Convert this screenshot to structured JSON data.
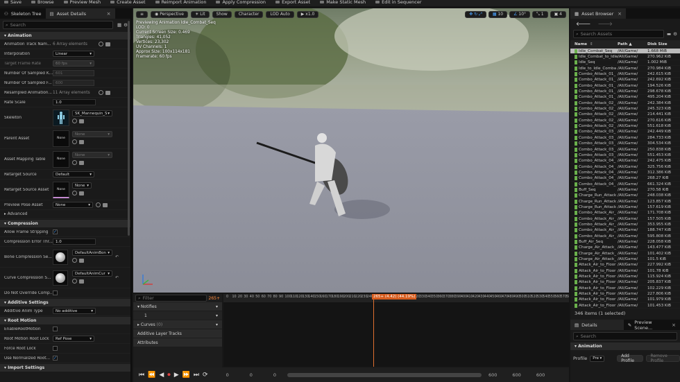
{
  "toolbar": {
    "items": [
      "Save",
      "Browse",
      "Preview Mesh",
      "Create Asset",
      "Reimport Animation",
      "Apply Compression",
      "Export Asset",
      "Make Static Mesh",
      "Edit in Sequencer"
    ]
  },
  "left_panel": {
    "tabs": [
      {
        "label": "Skeleton Tree"
      },
      {
        "label": "Asset Details"
      }
    ],
    "search_placeholder": "Search",
    "categories": {
      "animation": "Animation",
      "compression": "Compression",
      "additive": "Additive Settings",
      "root_motion": "Root Motion",
      "import": "Import Settings"
    },
    "rows": {
      "track_names": {
        "label": "Animation Track Nam...",
        "value": "6 Array elements"
      },
      "interpolation": {
        "label": "Interpolation",
        "value": "Linear"
      },
      "target_frame_rate": {
        "label": "Target Frame Rate",
        "value": "60 fps"
      },
      "num_sampled_keys": {
        "label": "Number Of Sampled K...",
        "value": "601"
      },
      "num_sampled_frames": {
        "label": "Number Of Sampled F...",
        "value": "600"
      },
      "resampled": {
        "label": "Resampled Animation...",
        "value": "11 Array elements"
      },
      "rate_scale": {
        "label": "Rate Scale",
        "value": "1.0"
      },
      "skeleton": {
        "label": "Skeleton",
        "value": "SK_Mannequin_S"
      },
      "parent_asset": {
        "label": "Parent Asset",
        "value": "None",
        "thumb": "None"
      },
      "asset_mapping": {
        "label": "Asset Mapping Table",
        "value": "None",
        "thumb": "None"
      },
      "retarget_source": {
        "label": "Retarget Source",
        "value": "Default"
      },
      "retarget_source_asset": {
        "label": "Retarget Source Asset",
        "value": "None",
        "thumb": "None"
      },
      "preview_pose": {
        "label": "Preview Pose Asset",
        "value": "None"
      },
      "advanced": {
        "label": "Advanced"
      },
      "allow_frame_strip": {
        "label": "Allow Frame Stripping"
      },
      "comp_error": {
        "label": "Compression Error Thr...",
        "value": "1.0"
      },
      "bone_comp": {
        "label": "Bone Compression Se...",
        "value": "DefaultAnimBon"
      },
      "curve_comp": {
        "label": "Curve Compression S...",
        "value": "DefaultAnimCur"
      },
      "no_override": {
        "label": "Do Not Override Comp..."
      },
      "additive_type": {
        "label": "Additive Anim Type",
        "value": "No additive"
      },
      "enable_rm": {
        "label": "EnableRootMotion"
      },
      "rm_lock": {
        "label": "Root Motion Root Lock",
        "value": "Ref Pose"
      },
      "force_lock": {
        "label": "Force Root Lock"
      },
      "use_norm": {
        "label": "Use Normalized Root..."
      }
    }
  },
  "viewport": {
    "buttons": [
      "Perspective",
      "Lit",
      "Show",
      "Character",
      "LOD Auto",
      "x1.0"
    ],
    "right_nums": [
      "10",
      "10°",
      "1",
      "4"
    ],
    "info": [
      "Previewing Animation Idle_Combat_Seq",
      "LOD: 0",
      "Current Screen Size: 0.469",
      "Triangles: 41,052",
      "Vertices: 23,302",
      "UV Channels: 1",
      "Approx Size: 100x114x181",
      "Framerate: 60 fps"
    ]
  },
  "timeline": {
    "filter_placeholder": "Filter",
    "frame_count": "265+",
    "tracks": {
      "notifies": "Notifies",
      "notify_index": "1",
      "curves": "Curves",
      "curves_count": "(0)",
      "additive_layer": "Additive Layer Tracks",
      "attributes": "Attributes"
    },
    "playhead": "265+ (4.42) (44.19%)",
    "ticks": [
      "0",
      "10",
      "20",
      "30",
      "40",
      "50",
      "60",
      "70",
      "80",
      "90",
      "100",
      "110",
      "120",
      "130",
      "140",
      "150",
      "160",
      "170",
      "180",
      "190",
      "200",
      "210",
      "220",
      "230",
      "240",
      "250",
      "260",
      "270",
      "280",
      "290",
      "300",
      "310",
      "320",
      "330",
      "340",
      "350",
      "360",
      "370",
      "380",
      "390",
      "400",
      "410",
      "420",
      "430",
      "440",
      "450",
      "460",
      "470",
      "480",
      "490",
      "500",
      "510",
      "520",
      "530",
      "540",
      "550",
      "560",
      "570",
      "580"
    ],
    "bottom_left": [
      "0",
      "0",
      "0"
    ],
    "bottom_right": [
      "600",
      "600",
      "600"
    ]
  },
  "asset_browser": {
    "tab": "Asset Browser",
    "search_placeholder": "Search Assets",
    "columns": [
      "Name",
      "Path",
      "Disk Size"
    ],
    "rows": [
      [
        "Idle_Combat_Seq",
        "/All/Game/",
        "1.668 MiB"
      ],
      [
        "Idle_Combat_to_Idle",
        "/All/Game/",
        "270.962 KiB"
      ],
      [
        "Idle_Seq",
        "/All/Game/",
        "1.002 MiB"
      ],
      [
        "Idle_to_Idle_Comba",
        "/All/Game/",
        "270.984 KiB"
      ],
      [
        "Combo_Attack_01_",
        "/All/Game/",
        "242.615 KiB"
      ],
      [
        "Combo_Attack_01_",
        "/All/Game/",
        "242.692 KiB"
      ],
      [
        "Combo_Attack_01_",
        "/All/Game/",
        "194.526 KiB"
      ],
      [
        "Combo_Attack_01_",
        "/All/Game/",
        "298.678 KiB"
      ],
      [
        "Combo_Attack_01_",
        "/All/Game/",
        "495.204 KiB"
      ],
      [
        "Combo_Attack_02_",
        "/All/Game/",
        "242.384 KiB"
      ],
      [
        "Combo_Attack_02_",
        "/All/Game/",
        "245.323 KiB"
      ],
      [
        "Combo_Attack_02_",
        "/All/Game/",
        "214.441 KiB"
      ],
      [
        "Combo_Attack_02_",
        "/All/Game/",
        "270.616 KiB"
      ],
      [
        "Combo_Attack_02_",
        "/All/Game/",
        "551.618 KiB"
      ],
      [
        "Combo_Attack_03_",
        "/All/Game/",
        "242.449 KiB"
      ],
      [
        "Combo_Attack_03_",
        "/All/Game/",
        "284.733 KiB"
      ],
      [
        "Combo_Attack_03_",
        "/All/Game/",
        "304.534 KiB"
      ],
      [
        "Combo_Attack_03_",
        "/All/Game/",
        "250.838 KiB"
      ],
      [
        "Combo_Attack_03_",
        "/All/Game/",
        "551.453 KiB"
      ],
      [
        "Combo_Attack_04_",
        "/All/Game/",
        "242.475 KiB"
      ],
      [
        "Combo_Attack_04_",
        "/All/Game/",
        "325.756 KiB"
      ],
      [
        "Combo_Attack_04_",
        "/All/Game/",
        "312.386 KiB"
      ],
      [
        "Combo_Attack_04_",
        "/All/Game/",
        "268.27 KiB"
      ],
      [
        "Combo_Attack_04_",
        "/All/Game/",
        "661.324 KiB"
      ],
      [
        "Buff_Seq",
        "/All/Game/",
        "270.58 KiB"
      ],
      [
        "Charge_Run_Attack",
        "/All/Game/",
        "248.038 KiB"
      ],
      [
        "Charge_Run_Attack",
        "/All/Game/",
        "123.857 KiB"
      ],
      [
        "Charge_Run_Attack",
        "/All/Game/",
        "157.619 KiB"
      ],
      [
        "Combo_Attack_Air_",
        "/All/Game/",
        "171.708 KiB"
      ],
      [
        "Combo_Attack_Air_",
        "/All/Game/",
        "157.505 KiB"
      ],
      [
        "Combo_Attack_Air_",
        "/All/Game/",
        "353.955 KiB"
      ],
      [
        "Combo_Attack_Air_",
        "/All/Game/",
        "188.747 KiB"
      ],
      [
        "Combo_Attack_Air_",
        "/All/Game/",
        "595.808 KiB"
      ],
      [
        "Buff_Air_Seq",
        "/All/Game/",
        "228.058 KiB"
      ],
      [
        "Charge_Air_Attack_",
        "/All/Game/",
        "143.477 KiB"
      ],
      [
        "Charge_Air_Attack_",
        "/All/Game/",
        "101.402 KiB"
      ],
      [
        "Charge_Air_Attack_",
        "/All/Game/",
        "101.5 KiB"
      ],
      [
        "Attack_Air_to_Floor",
        "/All/Game/",
        "227.992 KiB"
      ],
      [
        "Attack_Air_to_Floor",
        "/All/Game/",
        "101.78 KiB"
      ],
      [
        "Attack_Air_to_Floor",
        "/All/Game/",
        "115.924 KiB"
      ],
      [
        "Attack_Air_to_Floor",
        "/All/Game/",
        "205.837 KiB"
      ],
      [
        "Attack_Air_to_Floor",
        "/All/Game/",
        "102.229 KiB"
      ],
      [
        "Attack_Air_to_Floor",
        "/All/Game/",
        "227.806 KiB"
      ],
      [
        "Attack_Air_to_Floor",
        "/All/Game/",
        "101.979 KiB"
      ],
      [
        "Attack_Air_to_Floor",
        "/All/Game/",
        "101.453 KiB"
      ]
    ],
    "status": "346 items (1 selected)"
  },
  "details": {
    "tab": "Details",
    "tab2": "Preview Scene...",
    "search_placeholder": "Search",
    "category": "Animation",
    "profile_label": "Profile",
    "profile_value": "Pre",
    "add_profile": "Add Profile",
    "remove_profile": "Remove Profile"
  }
}
